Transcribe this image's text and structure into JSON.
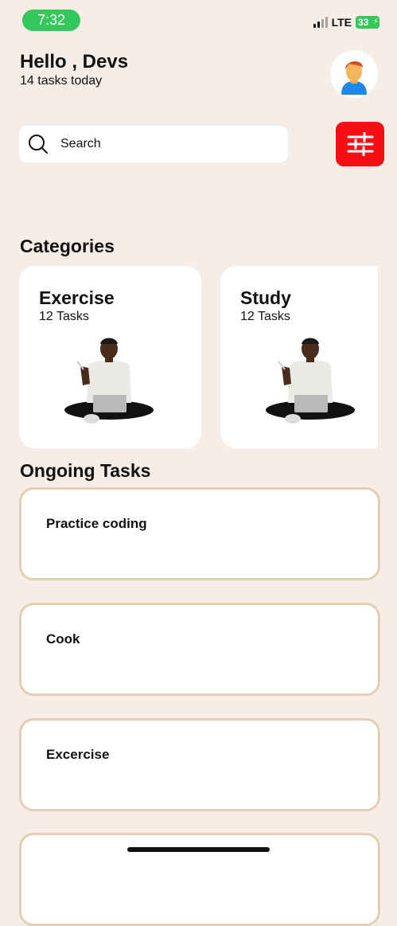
{
  "status_bar": {
    "time": "7:32",
    "network": "LTE",
    "battery": "33"
  },
  "header": {
    "greeting": "Hello , Devs",
    "subtitle": "14 tasks today",
    "avatar_icon": "man-avatar-icon"
  },
  "search": {
    "placeholder": "Search",
    "value": ""
  },
  "filter": {
    "icon": "sliders-icon",
    "color": "#f50f14"
  },
  "categories": {
    "title": "Categories",
    "items": [
      {
        "name": "Exercise",
        "count": "12 Tasks"
      },
      {
        "name": "Study",
        "count": "12 Tasks"
      }
    ]
  },
  "ongoing": {
    "title": "Ongoing Tasks",
    "tasks": [
      {
        "title": "Practice coding"
      },
      {
        "title": "Cook"
      },
      {
        "title": "Excercise"
      },
      {
        "title": ""
      }
    ]
  },
  "colors": {
    "background": "#f6eee6",
    "accent": "#f50f14",
    "task_border": "#e5cfb4",
    "status_green": "#34c759"
  }
}
